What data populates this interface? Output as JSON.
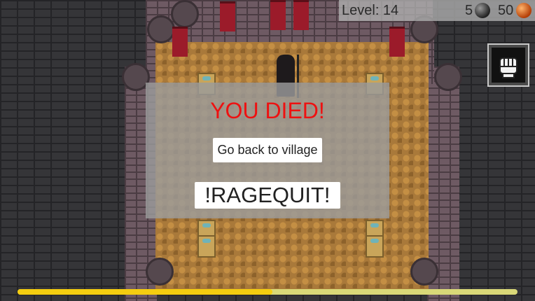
{
  "hud": {
    "level_text": "Level: 14",
    "dark_orbs": "5",
    "fire_orbs": "50",
    "dark_orb_icon": "dark-orb-icon",
    "fire_orb_icon": "fire-orb-icon",
    "ability_icon": "gauntlet-fist-icon"
  },
  "death_screen": {
    "title": "YOU DIED!",
    "go_back_label": "Go back to village",
    "ragequit_label": "!RAGEQUIT!"
  },
  "progress": {
    "fraction": 0.51
  },
  "colors": {
    "died_text": "#ee1111",
    "bar_fill": "#f4cd10",
    "bar_track": "#d9d878"
  }
}
